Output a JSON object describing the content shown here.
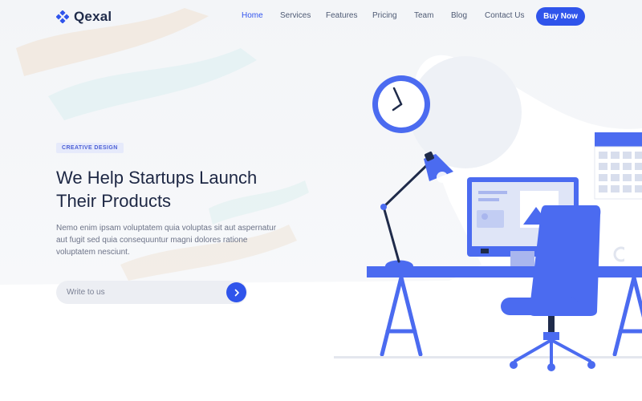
{
  "brand": {
    "name": "Qexal",
    "accent": "#2f54eb"
  },
  "nav": {
    "items": [
      {
        "label": "Home",
        "active": true
      },
      {
        "label": "Services",
        "active": false
      },
      {
        "label": "Features",
        "active": false
      },
      {
        "label": "Pricing",
        "active": false
      },
      {
        "label": "Team",
        "active": false
      },
      {
        "label": "Blog",
        "active": false
      },
      {
        "label": "Contact Us",
        "active": false
      }
    ],
    "cta_label": "Buy Now"
  },
  "hero": {
    "badge": "CREATIVE DESIGN",
    "title_line1": "We Help Startups Launch",
    "title_line2": "Their Products",
    "text_line1": "Nemo enim ipsam voluptatem quia voluptas sit aut aspernatur",
    "text_line2": "aut fugit sed quia consequuntur magni dolores ratione",
    "text_line3": "voluptatem nesciunt."
  },
  "subscribe": {
    "placeholder": "Write to us",
    "button_icon": "chevron-right-icon"
  },
  "illustration": {
    "clock_icon": "clock-icon",
    "clock_time": "12:25",
    "colors": {
      "primary": "#4b6bf0",
      "dark": "#1f2b4a",
      "light": "#dfe5f7"
    }
  }
}
